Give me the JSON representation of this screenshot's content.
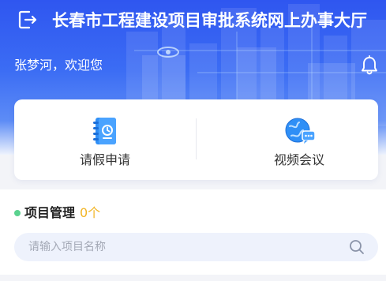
{
  "header": {
    "title": "长春市工程建设项目审批系统网上办事大厅",
    "exit_icon": "exit-icon",
    "greeting": "张梦河，欢迎您",
    "bell_icon": "bell-icon"
  },
  "actions": [
    {
      "label": "请假申请",
      "icon": "notebook-icon"
    },
    {
      "label": "视频会议",
      "icon": "video-meeting-icon"
    }
  ],
  "section": {
    "title": "项目管理",
    "count": "0个"
  },
  "search": {
    "placeholder": "请输入项目名称",
    "icon": "search-icon"
  },
  "colors": {
    "primary": "#2f56f0",
    "accent_count": "#f2b526",
    "dot": "#5ad28f",
    "search_bg": "#eef2fc"
  }
}
